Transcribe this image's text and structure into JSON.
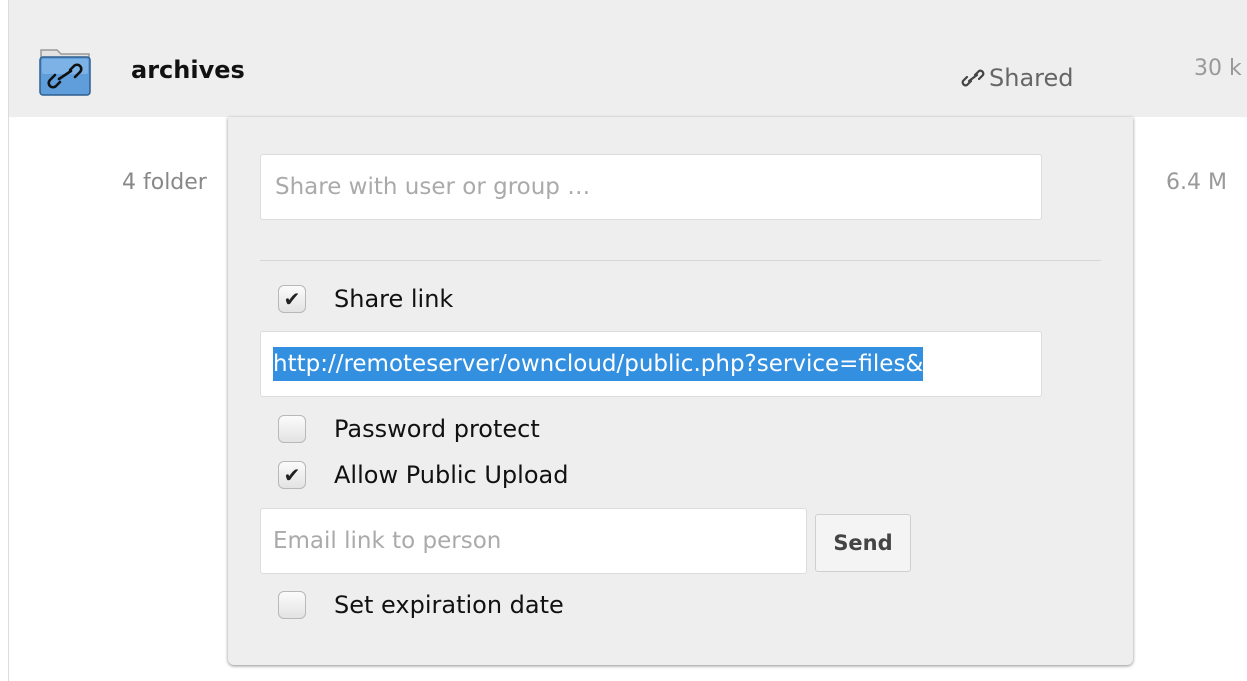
{
  "file_row": {
    "name": "archives",
    "icon": "shared-folder-icon",
    "share_action_label": "Shared",
    "size": "30 k"
  },
  "summary_row": {
    "label": "4 folder",
    "size": "6.4 M"
  },
  "share_dropdown": {
    "share_with_placeholder": "Share with user or group …",
    "share_link_label": "Share link",
    "share_link_checked": true,
    "link_url": "http://remoteserver/owncloud/public.php?service=files&",
    "password_protect_label": "Password protect",
    "password_protect_checked": false,
    "allow_public_upload_label": "Allow Public Upload",
    "allow_public_upload_checked": true,
    "email_placeholder": "Email link to person",
    "send_label": "Send",
    "expiration_label": "Set expiration date",
    "expiration_checked": false
  },
  "colors": {
    "row_highlight": "#eeeeee",
    "link_selection": "#3390e0",
    "folder_blue": "#4a8ccd"
  }
}
